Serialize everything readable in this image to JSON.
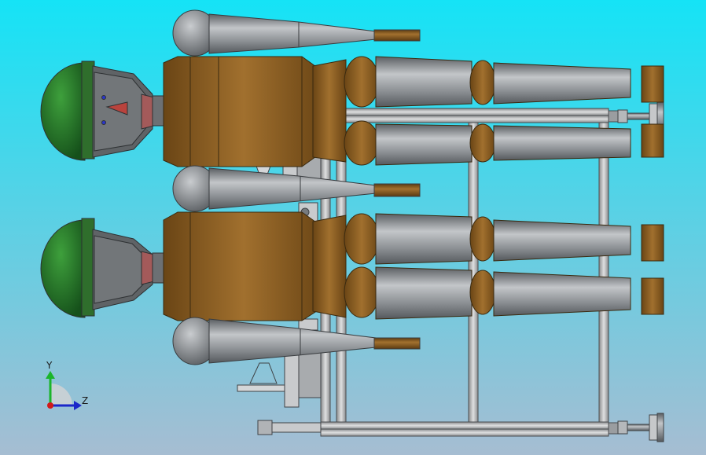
{
  "viewport": {
    "background_top": "#15e3f6",
    "background_bottom": "#a6bdd2"
  },
  "colors": {
    "bronze": "#7e5520",
    "bronze_light": "#a0712f",
    "steel": "#8b8f94",
    "steel_light": "#c2c5c8",
    "steel_dark": "#55595d",
    "helmet": "#1f6a22",
    "helmet_light": "#3ea03c",
    "frame": "#b7b9bb",
    "frame_dark": "#6f7275"
  },
  "axis_triad": {
    "y_label": "Y",
    "z_label": "Z",
    "y_color": "#1bb52b",
    "z_color": "#1b27c9",
    "origin_color": "#d21a1a"
  }
}
